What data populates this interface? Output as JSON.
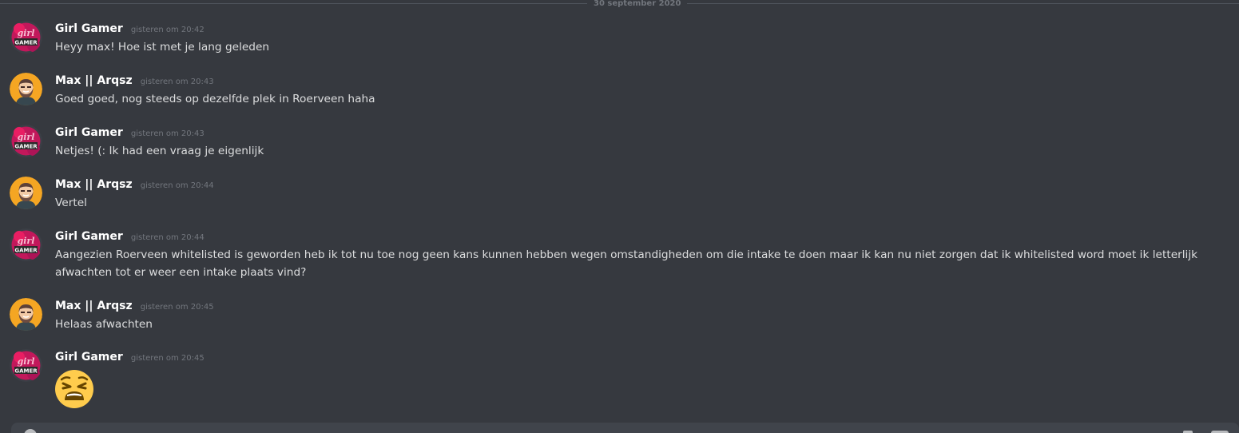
{
  "date_divider": "30 september 2020",
  "messages": [
    {
      "author": "Girl Gamer",
      "avatar": "girl-gamer-logo",
      "timestamp": "gisteren om 20:42",
      "text": "Heyy max! Hoe ist met je lang geleden"
    },
    {
      "author": "Max || Arqsz",
      "avatar": "bearded-man-avatar",
      "timestamp": "gisteren om 20:43",
      "text": "Goed goed, nog steeds op dezelfde plek in Roerveen haha"
    },
    {
      "author": "Girl Gamer",
      "avatar": "girl-gamer-logo",
      "timestamp": "gisteren om 20:43",
      "text": "Netjes! (: Ik had een vraag je eigenlijk"
    },
    {
      "author": "Max || Arqsz",
      "avatar": "bearded-man-avatar",
      "timestamp": "gisteren om 20:44",
      "text": "Vertel"
    },
    {
      "author": "Girl Gamer",
      "avatar": "girl-gamer-logo",
      "timestamp": "gisteren om 20:44",
      "text": "Aangezien Roerveen whitelisted is geworden heb ik tot nu toe nog geen kans kunnen hebben wegen omstandigheden om die intake te doen maar ik kan nu niet zorgen dat ik whitelisted word moet ik letterlijk afwachten tot er weer een intake plaats vind?"
    },
    {
      "author": "Max || Arqsz",
      "avatar": "bearded-man-avatar",
      "timestamp": "gisteren om 20:45",
      "text": "Helaas afwachten"
    },
    {
      "author": "Girl Gamer",
      "avatar": "girl-gamer-logo",
      "timestamp": "gisteren om 20:45",
      "text": "",
      "emoji": "weary-face-emoji"
    }
  ],
  "colors": {
    "background": "#36393f",
    "username": "#ffffff",
    "message_text": "#dcddde",
    "timestamp": "#72767d",
    "input_bar": "#40444b",
    "emoji_yellow": "#ffcc4d",
    "avatar_pink": "#c2185b",
    "avatar_orange": "#f5a623"
  }
}
